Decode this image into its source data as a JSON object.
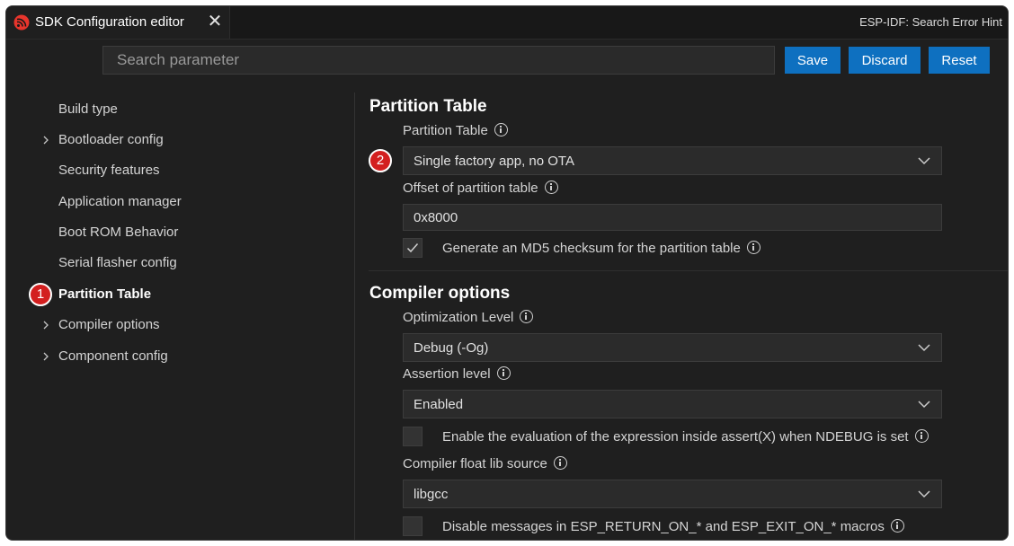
{
  "tab": {
    "title": "SDK Configuration editor",
    "icon": "espressif-logo-icon",
    "close": "✕"
  },
  "hint": "ESP-IDF: Search Error Hint",
  "search": {
    "placeholder": "Search parameter",
    "value": ""
  },
  "buttons": {
    "save": "Save",
    "discard": "Discard",
    "reset": "Reset"
  },
  "sidebar": {
    "items": [
      {
        "label": "Build type",
        "expandable": false,
        "active": false
      },
      {
        "label": "Bootloader config",
        "expandable": true,
        "active": false
      },
      {
        "label": "Security features",
        "expandable": false,
        "active": false
      },
      {
        "label": "Application manager",
        "expandable": false,
        "active": false
      },
      {
        "label": "Boot ROM Behavior",
        "expandable": false,
        "active": false
      },
      {
        "label": "Serial flasher config",
        "expandable": false,
        "active": false
      },
      {
        "label": "Partition Table",
        "expandable": false,
        "active": true
      },
      {
        "label": "Compiler options",
        "expandable": true,
        "active": false
      },
      {
        "label": "Component config",
        "expandable": true,
        "active": false
      }
    ]
  },
  "sections": {
    "partition": {
      "title": "Partition Table",
      "table_label": "Partition Table",
      "table_value": "Single factory app, no OTA",
      "offset_label": "Offset of partition table",
      "offset_value": "0x8000",
      "md5_label": "Generate an MD5 checksum for the partition table",
      "md5_checked": true
    },
    "compiler": {
      "title": "Compiler options",
      "opt_label": "Optimization Level",
      "opt_value": "Debug (-Og)",
      "assert_label": "Assertion level",
      "assert_value": "Enabled",
      "assert_eval_label": "Enable the evaluation of the expression inside assert(X) when NDEBUG is set",
      "assert_eval_checked": false,
      "float_label": "Compiler float lib source",
      "float_value": "libgcc",
      "disable_msgs_label": "Disable messages in ESP_RETURN_ON_* and ESP_EXIT_ON_* macros",
      "disable_msgs_checked": false
    }
  },
  "badges": {
    "one": "1",
    "two": "2"
  },
  "colors": {
    "accent": "#0e70c0",
    "badge": "#d31f1f",
    "background": "#1f1f1f"
  }
}
